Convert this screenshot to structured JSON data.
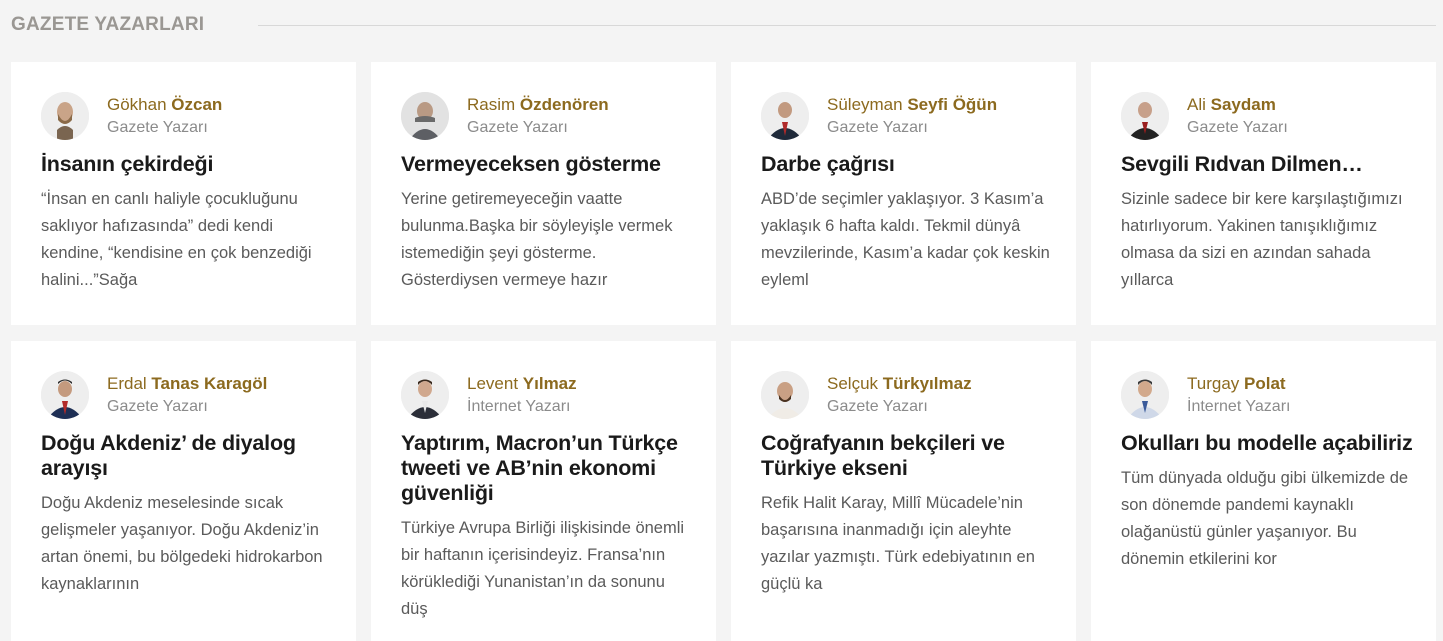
{
  "section": {
    "title": "GAZETE YAZARLARI"
  },
  "colors": {
    "author_accent": "#8c6a1f",
    "title": "#1a1a1a",
    "excerpt": "#5a5a5a",
    "background": "#f4f4f4"
  },
  "cards": [
    {
      "first": "Gökhan",
      "last": "Özcan",
      "role": "Gazete Yazarı",
      "title": "İnsanın çekirdeği",
      "excerpt": "“İnsan en canlı haliyle çocukluğunu saklıyor hafızasında” dedi kendi kendine, “kendisine en çok benzediği halini...”Sağa"
    },
    {
      "first": "Rasim",
      "last": "Özdenören",
      "role": "Gazete Yazarı",
      "title": "Vermeyeceksen gösterme",
      "excerpt": "Yerine getiremeyeceğin vaatte bulunma.Başka bir söyleyişle vermek istemediğin şeyi gösterme. Gösterdiysen vermeye hazır"
    },
    {
      "first": "Süleyman",
      "last": "Seyfi Öğün",
      "role": "Gazete Yazarı",
      "title": "Darbe çağrısı",
      "excerpt": "ABD’de seçimler yaklaşıyor. 3 Kasım’a yaklaşık 6 hafta kaldı. Tekmil dünyâ mevzilerinde, Kasım’a kadar çok keskin eyleml"
    },
    {
      "first": "Ali",
      "last": "Saydam",
      "role": "Gazete Yazarı",
      "title": "Sevgili Rıdvan Dilmen…",
      "excerpt": "Sizinle sadece bir kere karşılaştığımızı hatırlıyorum. Yakinen tanışıklığımız olmasa da sizi en azından sahada yıllarca"
    },
    {
      "first": "Erdal",
      "last": "Tanas Karagöl",
      "role": "Gazete Yazarı",
      "title": "Doğu Akdeniz’ de diyalog arayışı",
      "excerpt": "Doğu Akdeniz meselesinde sıcak gelişmeler yaşanıyor. Doğu Akdeniz’in artan önemi, bu bölgedeki hidrokarbon kaynaklarının"
    },
    {
      "first": "Levent",
      "last": "Yılmaz",
      "role": "İnternet Yazarı",
      "title": "Yaptırım, Macron’un Türkçe tweeti ve AB’nin ekonomi güvenliği",
      "excerpt": "Türkiye Avrupa Birliği ilişkisinde önemli bir haftanın içerisindeyiz. Fransa’nın körüklediği Yunanistan’ın da sonunu düş"
    },
    {
      "first": "Selçuk",
      "last": "Türkyılmaz",
      "role": "Gazete Yazarı",
      "title": "Coğrafyanın bekçileri ve Türkiye ekseni",
      "excerpt": "Refik Halit Karay, Millî Mücadele’nin başarısına inanmadığı için aleyhte yazılar yazmıştı. Türk edebiyatının en güçlü ka"
    },
    {
      "first": "Turgay",
      "last": "Polat",
      "role": "İnternet Yazarı",
      "title": "Okulları bu modelle açabiliriz",
      "excerpt": "Tüm dünyada olduğu gibi ülkemizde de son dönemde pandemi kaynaklı olağanüstü günler yaşanıyor. Bu dönemin etkilerini kor"
    }
  ]
}
